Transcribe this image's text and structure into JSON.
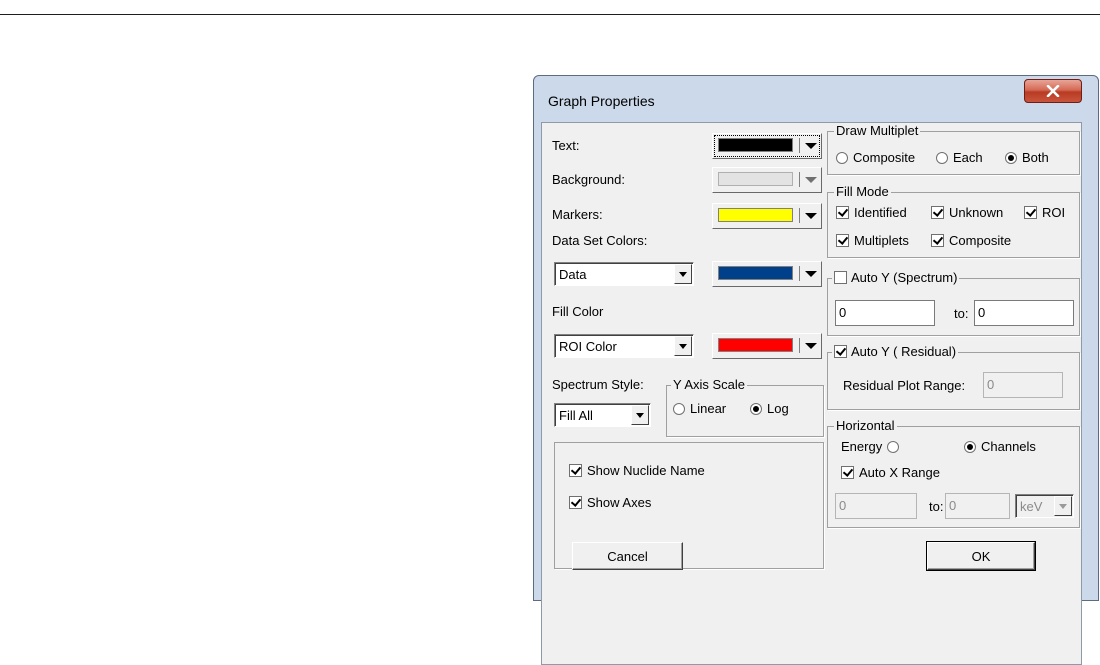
{
  "window": {
    "title": "Graph Properties"
  },
  "colors": {
    "text": "#000000",
    "background": "#e3e3e3",
    "markers": "#ffff00",
    "data_set": "#003f8a",
    "fill": "#ff0000"
  },
  "left": {
    "text_label": "Text:",
    "background_label": "Background:",
    "markers_label": "Markers:",
    "data_set_colors_label": "Data Set Colors:",
    "data_set_value": "Data",
    "fill_color_label": "Fill Color",
    "fill_color_value": "ROI Color",
    "spectrum_style_label": "Spectrum Style:",
    "spectrum_style_value": "Fill All",
    "y_axis_scale": {
      "title": "Y Axis Scale",
      "linear": "Linear",
      "log": "Log"
    },
    "show_nuclide_name": "Show Nuclide Name",
    "show_axes": "Show Axes"
  },
  "draw_multiplet": {
    "title": "Draw Multiplet",
    "composite": "Composite",
    "each": "Each",
    "both": "Both"
  },
  "fill_mode": {
    "title": "Fill Mode",
    "identified": "Identified",
    "unknown": "Unknown",
    "roi": "ROI",
    "multiplets": "Multiplets",
    "composite": "Composite"
  },
  "auto_y_spectrum": {
    "title": "Auto Y (Spectrum)",
    "from": "0",
    "to_label": "to:",
    "to": "0"
  },
  "auto_y_residual": {
    "title": "Auto Y ( Residual)",
    "range_label": "Residual Plot Range:",
    "range_value": "0"
  },
  "horizontal": {
    "title": "Horizontal",
    "energy": "Energy",
    "channels": "Channels",
    "auto_x_range": "Auto X Range",
    "from": "0",
    "to_label": "to:",
    "to": "0",
    "unit": "keV"
  },
  "buttons": {
    "cancel": "Cancel",
    "ok": "OK"
  }
}
